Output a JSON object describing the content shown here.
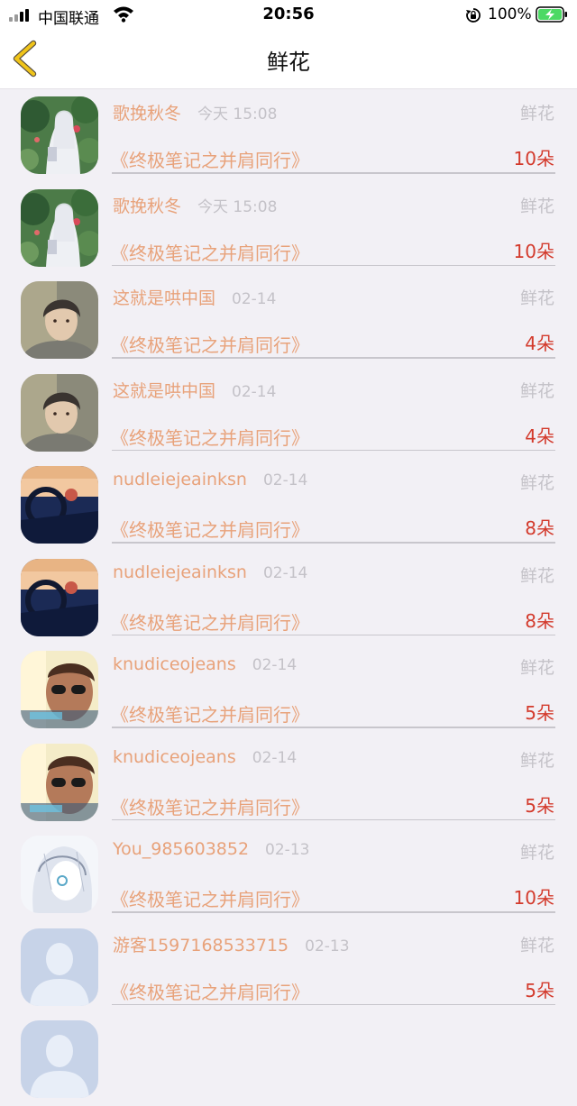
{
  "status_bar": {
    "carrier": "中国联通",
    "time": "20:56",
    "battery": "100%"
  },
  "nav": {
    "title": "鲜花",
    "back_icon": "chevron-left-icon"
  },
  "colors": {
    "accent_yellow": "#f0c419",
    "username": "#e8a27a",
    "count": "#d33a2c",
    "muted": "#c4c2c8"
  },
  "records": [
    {
      "user": "歌挽秋冬",
      "time": "今天 15:08",
      "gift": "鲜花",
      "book": "《终极笔记之并肩同行》",
      "count": "10朵",
      "avatar": "winter"
    },
    {
      "user": "歌挽秋冬",
      "time": "今天 15:08",
      "gift": "鲜花",
      "book": "《终极笔记之并肩同行》",
      "count": "10朵",
      "avatar": "winter"
    },
    {
      "user": "这就是哄中国",
      "time": "02-14",
      "gift": "鲜花",
      "book": "《终极笔记之并肩同行》",
      "count": "4朵",
      "avatar": "boy"
    },
    {
      "user": "这就是哄中国",
      "time": "02-14",
      "gift": "鲜花",
      "book": "《终极笔记之并肩同行》",
      "count": "4朵",
      "avatar": "boy"
    },
    {
      "user": "nudleiejeainksn",
      "time": "02-14",
      "gift": "鲜花",
      "book": "《终极笔记之并肩同行》",
      "count": "8朵",
      "avatar": "car"
    },
    {
      "user": "nudleiejeainksn",
      "time": "02-14",
      "gift": "鲜花",
      "book": "《终极笔记之并肩同行》",
      "count": "8朵",
      "avatar": "car"
    },
    {
      "user": "knudiceojeans",
      "time": "02-14",
      "gift": "鲜花",
      "book": "《终极笔记之并肩同行》",
      "count": "5朵",
      "avatar": "sunglasses"
    },
    {
      "user": "knudiceojeans",
      "time": "02-14",
      "gift": "鲜花",
      "book": "《终极笔记之并肩同行》",
      "count": "5朵",
      "avatar": "sunglasses"
    },
    {
      "user": "You_985603852",
      "time": "02-13",
      "gift": "鲜花",
      "book": "《终极笔记之并肩同行》",
      "count": "10朵",
      "avatar": "sketch"
    },
    {
      "user": "游客1597168533715",
      "time": "02-13",
      "gift": "鲜花",
      "book": "《终极笔记之并肩同行》",
      "count": "5朵",
      "avatar": "default"
    }
  ]
}
